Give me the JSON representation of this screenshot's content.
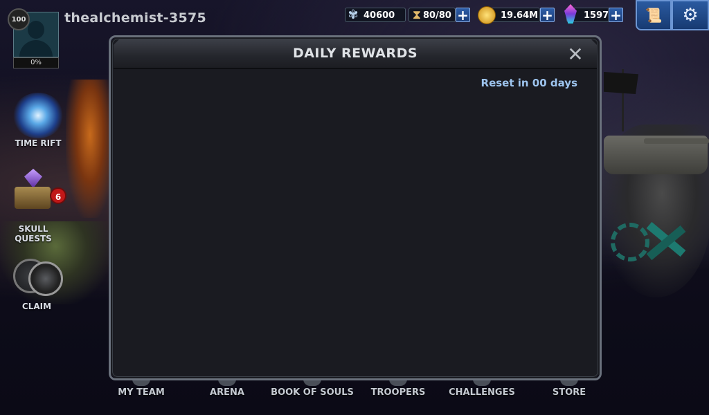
{
  "player": {
    "level": "100",
    "name": "thealchemist-3575",
    "xp_percent": "0%"
  },
  "resources": [
    {
      "name": "troop-power",
      "icon": "skull-crest-icon",
      "value": "40600",
      "has_plus": false
    },
    {
      "name": "energy",
      "icon": "hourglass-icon",
      "value": "80/80",
      "has_plus": true
    },
    {
      "name": "gold",
      "icon": "gold-coin-icon",
      "value": "19.64M",
      "has_plus": true
    },
    {
      "name": "crystals",
      "icon": "crystal-icon",
      "value": "1597",
      "has_plus": true
    }
  ],
  "top_buttons": [
    {
      "name": "quests-scroll-button",
      "icon": "scroll-icon",
      "glyph": "📜"
    },
    {
      "name": "settings-button",
      "icon": "gear-icon",
      "glyph": "⚙"
    }
  ],
  "sidebar": {
    "time_rift": "TIME RIFT",
    "skull_quests": "SKULL\nQUESTS",
    "skull_quests_badge": "6",
    "claim": "CLAIM"
  },
  "modal": {
    "title": "DAILY REWARDS",
    "close_glyph": "✕",
    "reset_text": "Reset in 00 days"
  },
  "bottom_nav": [
    {
      "label": "MY TEAM"
    },
    {
      "label": "ARENA"
    },
    {
      "label": "BOOK OF SOULS"
    },
    {
      "label": "TROOPERS"
    },
    {
      "label": "CHALLENGES"
    },
    {
      "label": "STORE"
    }
  ],
  "colors": {
    "accent_blue": "#2e5ea8",
    "reset_text": "#9dc4ee",
    "badge_red": "#c01818",
    "modal_bg": "#1a1b21"
  }
}
